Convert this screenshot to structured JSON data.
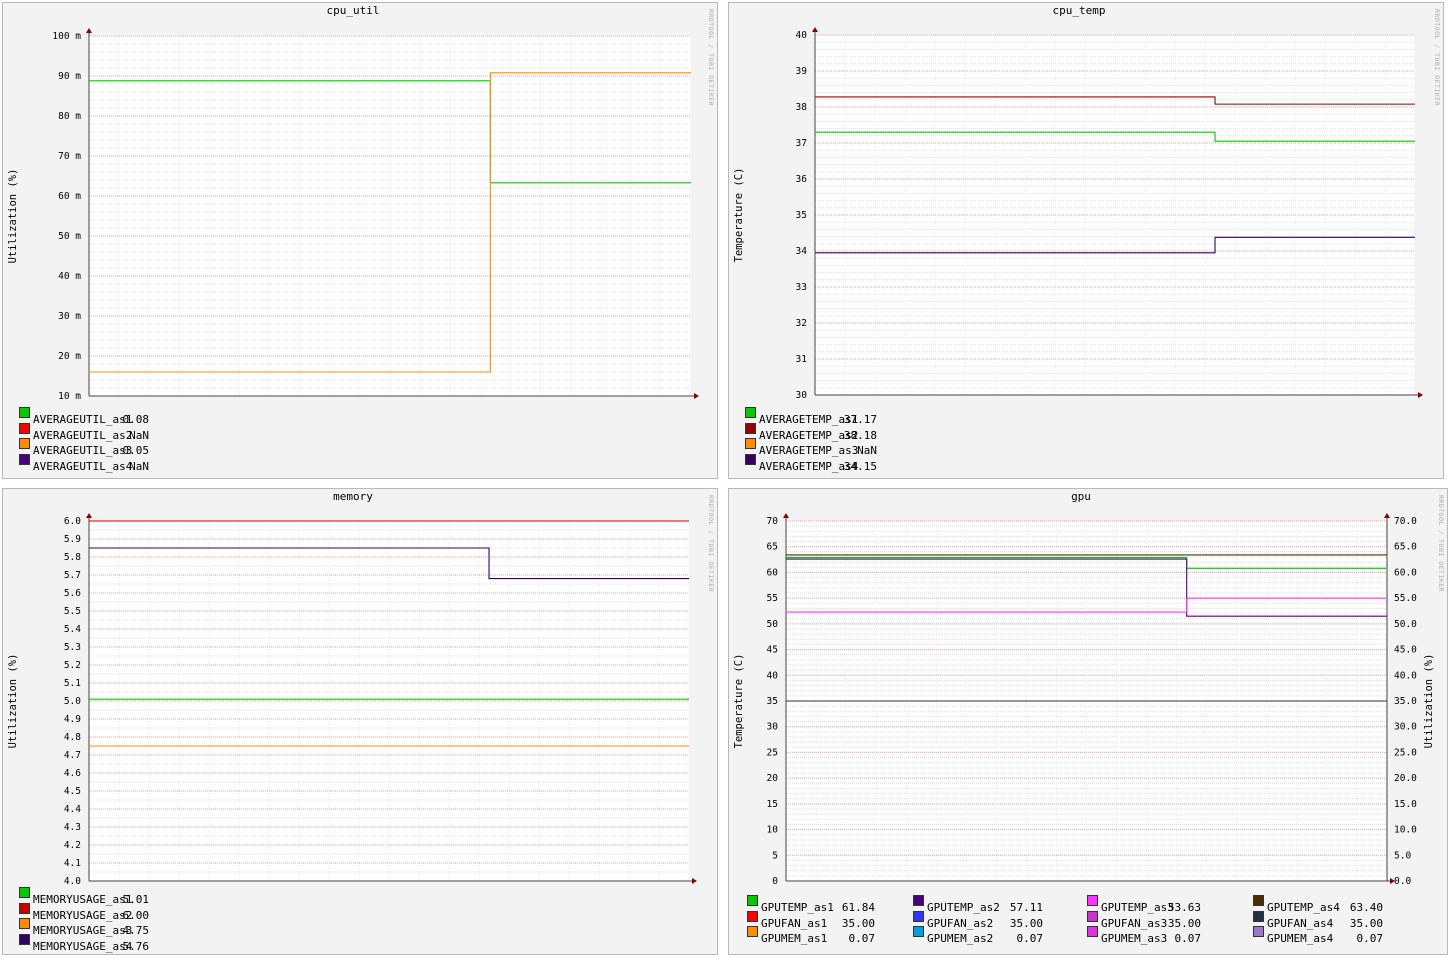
{
  "side_label": "RRDTOOL / TOBI OETIKER",
  "chart_data": [
    {
      "type": "line",
      "title": "cpu_util",
      "ylabel": "Utilization (%)",
      "ylim": [
        0.01,
        0.1
      ],
      "yticks": [
        0.01,
        0.02,
        0.03,
        0.04,
        0.05,
        0.06,
        0.07,
        0.08,
        0.09,
        0.1
      ],
      "ytick_labels": [
        "10 m",
        "20 m",
        "30 m",
        "40 m",
        "50 m",
        "60 m",
        "70 m",
        "80 m",
        "90 m",
        "100 m"
      ],
      "minor_step": 0.002,
      "grid": true,
      "series": [
        {
          "name": "AVERAGEUTIL_as1",
          "color": "#00cc00",
          "value_text": "0.08",
          "segments": [
            [
              0,
              0.6667,
              0.0888
            ],
            [
              0.6667,
              1,
              0.0633
            ]
          ]
        },
        {
          "name": "AVERAGEUTIL_as2",
          "color": "#ff0000",
          "value_text": "NaN",
          "segments": []
        },
        {
          "name": "AVERAGEUTIL_as3",
          "color": "#ff8c00",
          "value_text": "0.05",
          "segments": [
            [
              0,
              0.6667,
              0.016
            ],
            [
              0.6667,
              1,
              0.0908
            ]
          ]
        },
        {
          "name": "AVERAGEUTIL_as4",
          "color": "#4b0082",
          "value_text": "NaN",
          "segments": []
        }
      ]
    },
    {
      "type": "line",
      "title": "cpu_temp",
      "ylabel": "Temperature (C)",
      "ylim": [
        30,
        40
      ],
      "yticks": [
        30,
        31,
        32,
        33,
        34,
        35,
        36,
        37,
        38,
        39,
        40
      ],
      "ytick_labels": [
        "30",
        "31",
        "32",
        "33",
        "34",
        "35",
        "36",
        "37",
        "38",
        "39",
        "40"
      ],
      "minor_step": 0.2,
      "grid": true,
      "series": [
        {
          "name": "AVERAGETEMP_as1",
          "color": "#00cc00",
          "value_text": "37.17",
          "segments": [
            [
              0,
              0.6667,
              37.3
            ],
            [
              0.6667,
              1,
              37.05
            ]
          ]
        },
        {
          "name": "AVERAGETEMP_as2",
          "color": "#990000",
          "value_text": "38.18",
          "segments": [
            [
              0,
              0.6667,
              38.28
            ],
            [
              0.6667,
              1,
              38.08
            ]
          ]
        },
        {
          "name": "AVERAGETEMP_as3",
          "color": "#ff8c00",
          "value_text": "NaN",
          "segments": []
        },
        {
          "name": "AVERAGETEMP_as4",
          "color": "#330066",
          "value_text": "34.15",
          "segments": [
            [
              0,
              0.6667,
              33.95
            ],
            [
              0.6667,
              1,
              34.38
            ]
          ]
        }
      ]
    },
    {
      "type": "line",
      "title": "memory",
      "ylabel": "Utilization (%)",
      "ylim": [
        4.0,
        6.0
      ],
      "yticks": [
        4.0,
        4.1,
        4.2,
        4.3,
        4.4,
        4.5,
        4.6,
        4.7,
        4.8,
        4.9,
        5.0,
        5.1,
        5.2,
        5.3,
        5.4,
        5.5,
        5.6,
        5.7,
        5.8,
        5.9,
        6.0
      ],
      "ytick_labels": [
        "4.0",
        "4.1",
        "4.2",
        "4.3",
        "4.4",
        "4.5",
        "4.6",
        "4.7",
        "4.8",
        "4.9",
        "5.0",
        "5.1",
        "5.2",
        "5.3",
        "5.4",
        "5.5",
        "5.6",
        "5.7",
        "5.8",
        "5.9",
        "6.0"
      ],
      "minor_step": 0.05,
      "grid": true,
      "series": [
        {
          "name": "MEMORYUSAGE_as1",
          "color": "#00cc00",
          "value_text": "5.01",
          "segments": [
            [
              0,
              1,
              5.01
            ]
          ]
        },
        {
          "name": "MEMORYUSAGE_as2",
          "color": "#cc0000",
          "value_text": "6.00",
          "segments": [
            [
              0,
              1,
              6.0
            ]
          ]
        },
        {
          "name": "MEMORYUSAGE_as3",
          "color": "#ff8c00",
          "value_text": "4.75",
          "segments": [
            [
              0,
              1,
              4.75
            ]
          ]
        },
        {
          "name": "MEMORYUSAGE_as4",
          "color": "#330066",
          "value_text": "5.76",
          "segments": [
            [
              0,
              0.6667,
              5.85
            ],
            [
              0.6667,
              1,
              5.68
            ]
          ]
        }
      ]
    },
    {
      "type": "line",
      "title": "gpu",
      "ylabel": "Temperature (C)",
      "ylabel_right": "Utilization (%)",
      "ylim": [
        0,
        70
      ],
      "yticks": [
        0,
        5,
        10,
        15,
        20,
        25,
        30,
        35,
        40,
        45,
        50,
        55,
        60,
        65,
        70
      ],
      "ytick_labels": [
        "0",
        "5",
        "10",
        "15",
        "20",
        "25",
        "30",
        "35",
        "40",
        "45",
        "50",
        "55",
        "60",
        "65",
        "70"
      ],
      "ytick_labels_right": [
        "0.0",
        "5.0",
        "10.0",
        "15.0",
        "20.0",
        "25.0",
        "30.0",
        "35.0",
        "40.0",
        "45.0",
        "50.0",
        "55.0",
        "60.0",
        "65.0",
        "70.0"
      ],
      "minor_step": 1,
      "grid": true,
      "series": [
        {
          "name": "GPUTEMP_as1",
          "color": "#00cc00",
          "value_text": "61.84",
          "segments": [
            [
              0,
              0.6667,
              62.9
            ],
            [
              0.6667,
              1,
              60.8
            ]
          ]
        },
        {
          "name": "GPUFAN_as1",
          "color": "#ff0000",
          "value_text": "35.00",
          "segments": [
            [
              0,
              1,
              35.0
            ]
          ]
        },
        {
          "name": "GPUMEM_as1",
          "color": "#ff8c00",
          "value_text": "0.07",
          "segments": []
        },
        {
          "name": "GPUTEMP_as2",
          "color": "#4b0082",
          "value_text": "57.11",
          "segments": [
            [
              0,
              0.6667,
              62.6
            ],
            [
              0.6667,
              1,
              51.5
            ]
          ]
        },
        {
          "name": "GPUFAN_as2",
          "color": "#3333ff",
          "value_text": "35.00",
          "segments": [
            [
              0,
              1,
              35.0
            ]
          ]
        },
        {
          "name": "GPUMEM_as2",
          "color": "#00a0e0",
          "value_text": "0.07",
          "segments": []
        },
        {
          "name": "GPUTEMP_as3",
          "color": "#ff33ff",
          "value_text": "53.63",
          "segments": [
            [
              0,
              0.6667,
              52.3
            ],
            [
              0.6667,
              1,
              55.0
            ]
          ]
        },
        {
          "name": "GPUFAN_as3",
          "color": "#cc33cc",
          "value_text": "35.00",
          "segments": [
            [
              0,
              1,
              35.0
            ]
          ]
        },
        {
          "name": "GPUMEM_as3",
          "color": "#e033e0",
          "value_text": "0.07",
          "segments": []
        },
        {
          "name": "GPUTEMP_as4",
          "color": "#4a3000",
          "value_text": "63.40",
          "segments": [
            [
              0,
              1,
              63.4
            ]
          ]
        },
        {
          "name": "GPUFAN_as4",
          "color": "#223344",
          "value_text": "35.00",
          "segments": [
            [
              0,
              1,
              35.0
            ]
          ]
        },
        {
          "name": "GPUMEM_as4",
          "color": "#9977cc",
          "value_text": "0.07",
          "segments": []
        }
      ]
    }
  ]
}
